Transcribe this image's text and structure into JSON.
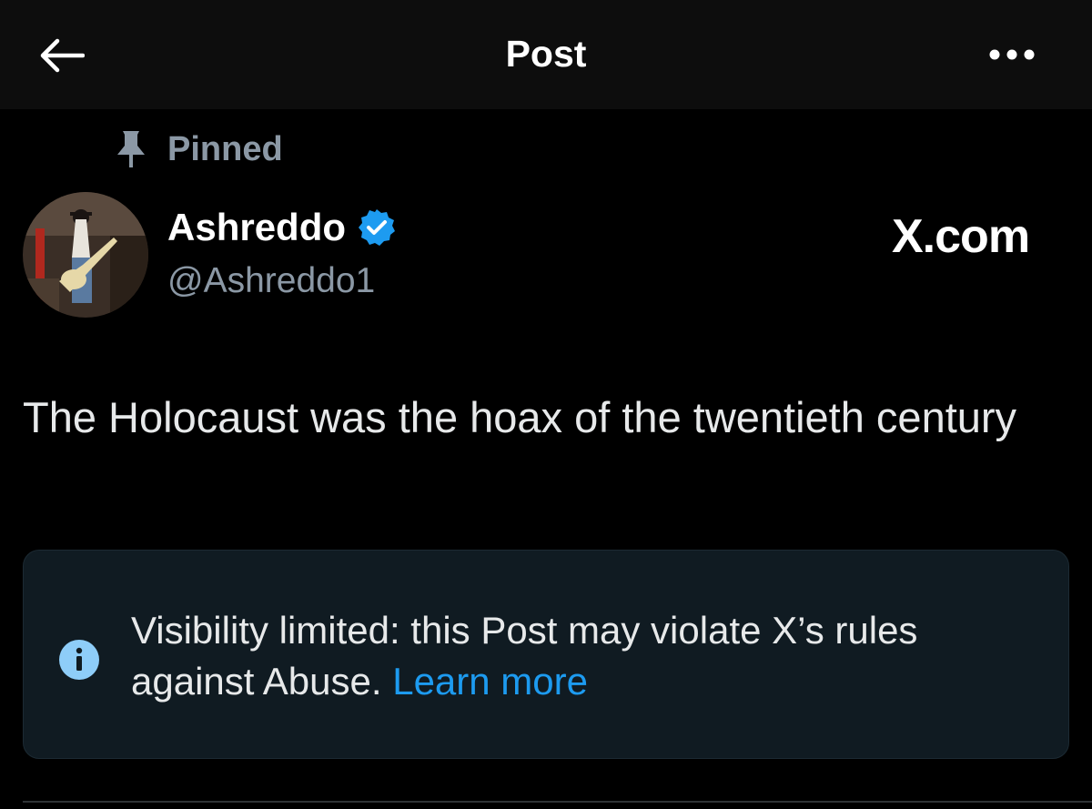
{
  "header": {
    "title": "Post",
    "back_icon": "arrow-left-icon",
    "more_icon": "more-horizontal-icon"
  },
  "pinned": {
    "label": "Pinned",
    "icon": "pin-icon"
  },
  "author": {
    "name": "Ashreddo",
    "handle": "@Ashreddo1",
    "verified": true,
    "verified_color": "#1d9bf0"
  },
  "watermark": "X.com",
  "post": {
    "text": "The Holocaust was the hoax of the twentieth century"
  },
  "notice": {
    "icon": "info-icon",
    "text": "Visibility limited: this Post may violate X’s rules against Abuse. ",
    "link_label": "Learn more",
    "link_color": "#1d9bf0"
  },
  "colors": {
    "background": "#000000",
    "header_bg": "#0d0d0d",
    "secondary_text": "#8b98a5",
    "notice_bg": "#101b22"
  }
}
